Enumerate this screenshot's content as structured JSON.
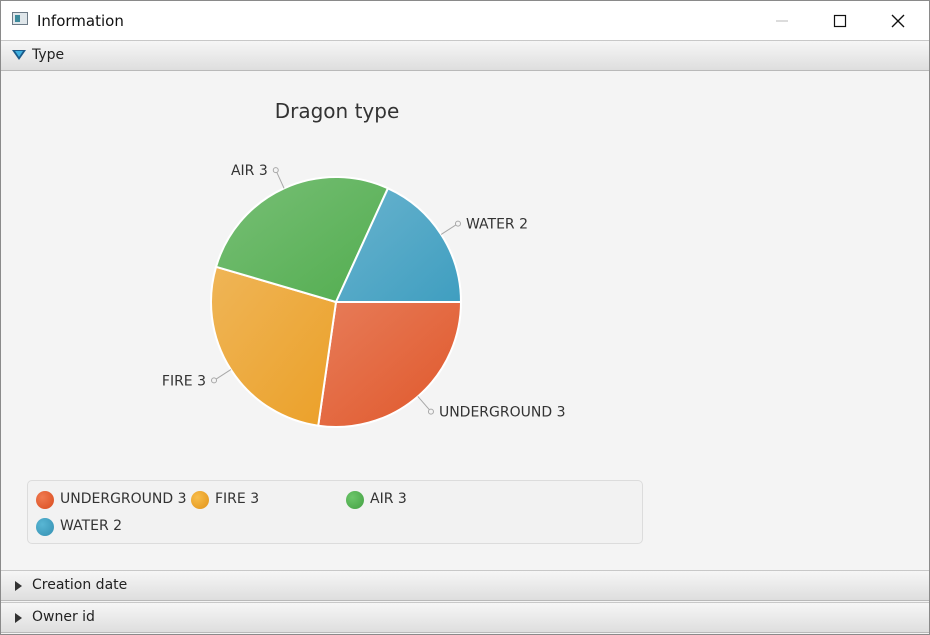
{
  "window": {
    "title": "Information"
  },
  "panes": {
    "type_label": "Type",
    "creation_date_label": "Creation date",
    "owner_id_label": "Owner id"
  },
  "chart_data": {
    "type": "pie",
    "title": "Dragon type",
    "slices": [
      {
        "label": "UNDERGROUND 3",
        "category": "UNDERGROUND",
        "value": 3,
        "color": "#e0572a"
      },
      {
        "label": "FIRE 3",
        "category": "FIRE",
        "value": 3,
        "color": "#eba028"
      },
      {
        "label": "AIR 3",
        "category": "AIR",
        "value": 3,
        "color": "#52ad4f"
      },
      {
        "label": "WATER 2",
        "category": "WATER",
        "value": 2,
        "color": "#3f9ec0"
      }
    ],
    "legend": [
      "UNDERGROUND 3",
      "FIRE 3",
      "AIR 3",
      "WATER 2"
    ],
    "legend_position": "bottom"
  }
}
